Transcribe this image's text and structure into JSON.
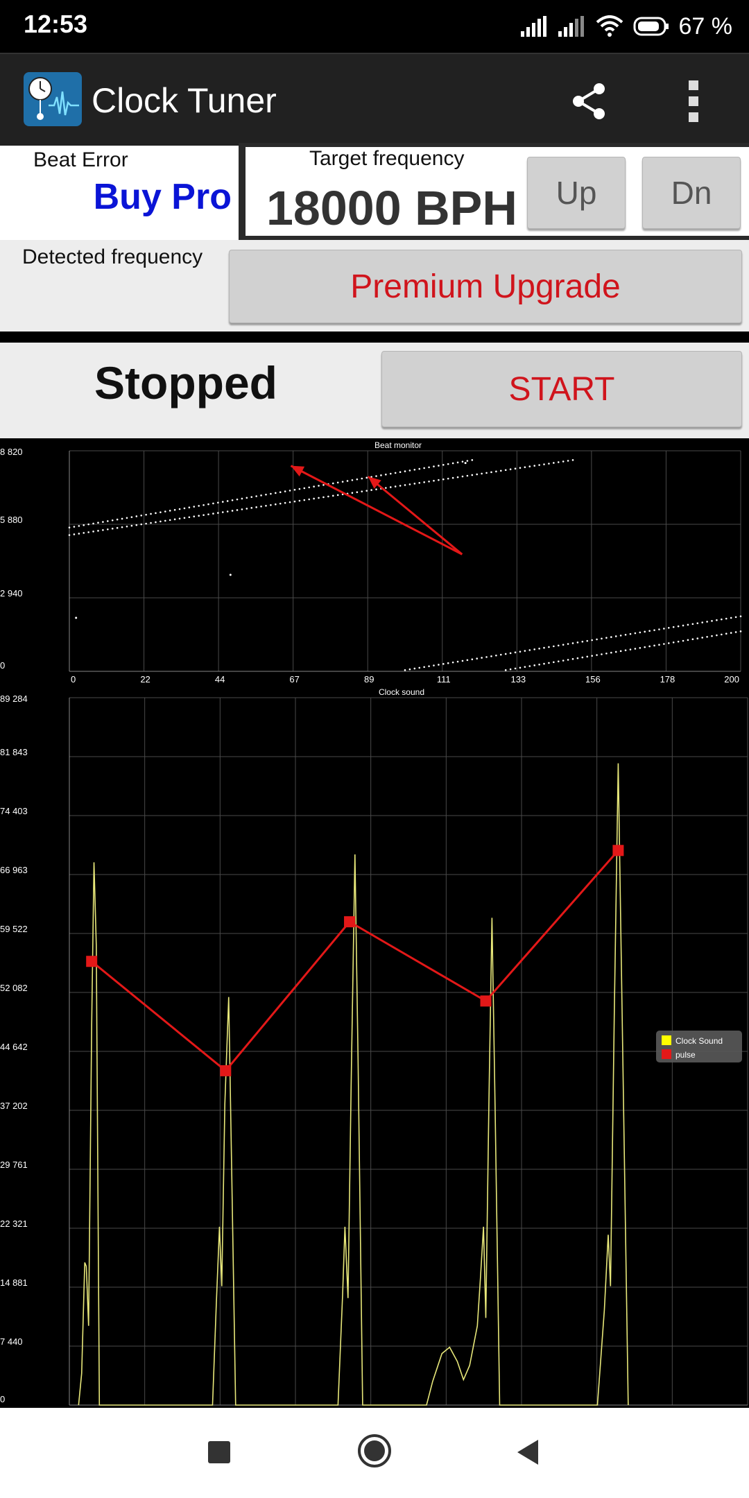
{
  "status_bar": {
    "time": "12:53",
    "battery": "67 %"
  },
  "app": {
    "title": "Clock Tuner"
  },
  "beat_error": {
    "label": "Beat Error",
    "value": "Buy Pro"
  },
  "target": {
    "label": "Target frequency",
    "value": "18000 BPH",
    "up_label": "Up",
    "down_label": "Dn"
  },
  "detected": {
    "label": "Detected frequency",
    "upgrade_label": "Premium Upgrade"
  },
  "run": {
    "status": "Stopped",
    "start_label": "START"
  },
  "colors": {
    "accent_red": "#d0141c",
    "buy_pro_blue": "#0a14d6",
    "signal_yellow": "#ffff00",
    "pulse_red": "#e31818"
  },
  "chart_data": [
    {
      "type": "scatter",
      "title": "Beat monitor",
      "xlim": [
        0,
        200
      ],
      "ylim": [
        0,
        8820
      ],
      "x_ticks": [
        "0",
        "22",
        "44",
        "67",
        "89",
        "111",
        "133",
        "156",
        "178",
        "200"
      ],
      "y_ticks": [
        "0",
        "2 940",
        "5 880",
        "8 820"
      ],
      "series": [
        {
          "points": [
            [
              0,
              5450
            ],
            [
              150,
              8450
            ]
          ]
        },
        {
          "points": [
            [
              0,
              5750
            ],
            [
              120,
              8450
            ]
          ]
        },
        {
          "points": [
            [
              100,
              50
            ],
            [
              200,
              2200
            ]
          ]
        },
        {
          "points": [
            [
              130,
              50
            ],
            [
              200,
              1600
            ]
          ]
        }
      ],
      "stray_points": [
        [
          2,
          2140
        ],
        [
          48,
          3860
        ],
        [
          118,
          8330
        ]
      ],
      "annotations": [
        {
          "from": [
            117,
            4680
          ],
          "to": [
            66,
            8220
          ]
        },
        {
          "from": [
            117,
            4680
          ],
          "to": [
            89,
            7790
          ]
        }
      ],
      "grid": true
    },
    {
      "type": "line",
      "title": "Clock sound",
      "xlim": [
        0,
        44055
      ],
      "ylim": [
        0,
        89284
      ],
      "x_ticks": [
        "0",
        "4 895",
        "9 790",
        "14 685",
        "19 580",
        "24 475",
        "29 370",
        "34 265",
        "39 160",
        "44 055"
      ],
      "y_ticks": [
        "0",
        "7 440",
        "14 881",
        "22 321",
        "29 761",
        "37 202",
        "44 642",
        "52 082",
        "59 522",
        "66 963",
        "74 403",
        "81 843",
        "89 284"
      ],
      "legend": {
        "position": "right",
        "items": [
          "Clock Sound",
          "pulse"
        ]
      },
      "series": [
        {
          "name": "Clock Sound",
          "points": [
            [
              600,
              0
            ],
            [
              800,
              4000
            ],
            [
              1000,
              18000
            ],
            [
              1100,
              17500
            ],
            [
              1250,
              10000
            ],
            [
              1450,
              48000
            ],
            [
              1600,
              68500
            ],
            [
              1750,
              58000
            ],
            [
              1950,
              0
            ],
            [
              9300,
              0
            ],
            [
              9550,
              13000
            ],
            [
              9750,
              22500
            ],
            [
              9900,
              15000
            ],
            [
              10100,
              38000
            ],
            [
              10350,
              51500
            ],
            [
              10550,
              29000
            ],
            [
              10800,
              0
            ],
            [
              17450,
              0
            ],
            [
              17750,
              14000
            ],
            [
              17900,
              22500
            ],
            [
              18100,
              13500
            ],
            [
              18300,
              40000
            ],
            [
              18550,
              69500
            ],
            [
              18750,
              44000
            ],
            [
              19050,
              0
            ],
            [
              23200,
              0
            ],
            [
              23600,
              3000
            ],
            [
              24200,
              6500
            ],
            [
              24700,
              7300
            ],
            [
              25200,
              5500
            ],
            [
              25600,
              3200
            ],
            [
              26000,
              5000
            ],
            [
              26500,
              10000
            ],
            [
              26700,
              16000
            ],
            [
              26900,
              22500
            ],
            [
              27050,
              11000
            ],
            [
              27250,
              38000
            ],
            [
              27450,
              61500
            ],
            [
              27650,
              38000
            ],
            [
              27950,
              0
            ],
            [
              34300,
              0
            ],
            [
              34750,
              12000
            ],
            [
              35000,
              21500
            ],
            [
              35150,
              15000
            ],
            [
              35400,
              50000
            ],
            [
              35650,
              81000
            ],
            [
              35900,
              50000
            ],
            [
              36300,
              0
            ]
          ]
        },
        {
          "name": "pulse",
          "points": [
            [
              1450,
              56000
            ],
            [
              10150,
              42200
            ],
            [
              18200,
              61000
            ],
            [
              27050,
              51000
            ],
            [
              35650,
              70000
            ]
          ]
        }
      ],
      "grid": true
    }
  ]
}
